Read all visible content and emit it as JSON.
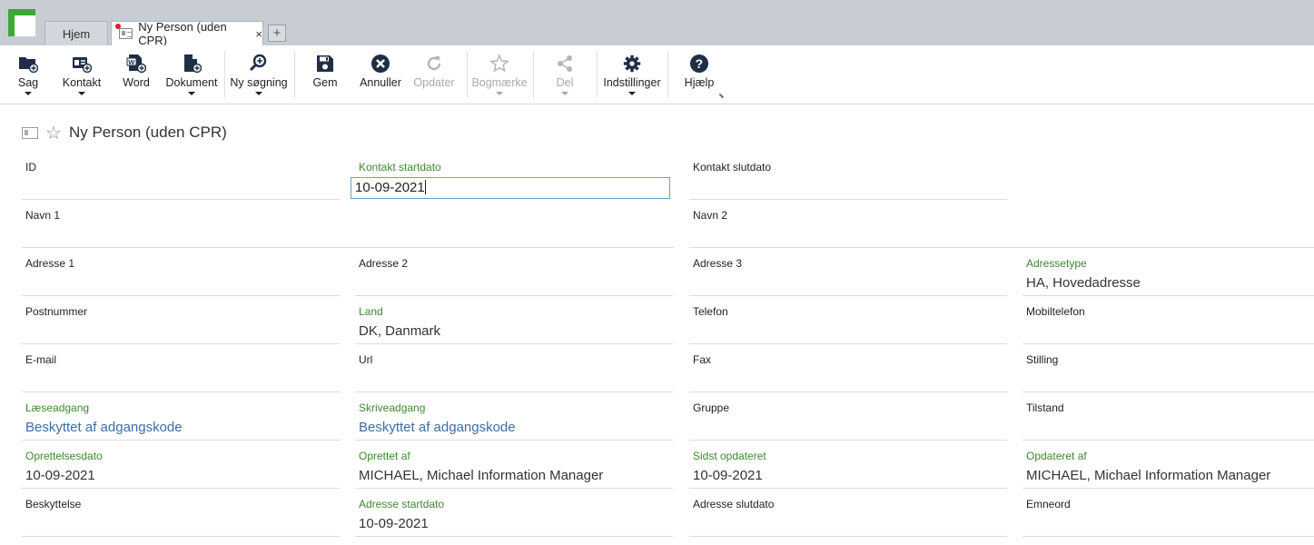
{
  "tabs": {
    "home": "Hjem",
    "active": "Ny Person (uden CPR)",
    "close": "×",
    "add": "+"
  },
  "ribbon": {
    "items": [
      {
        "label": "Sag",
        "icon": "folder-add-icon"
      },
      {
        "label": "Kontakt",
        "icon": "contact-add-icon"
      },
      {
        "label": "Word",
        "icon": "word-add-icon"
      },
      {
        "label": "Dokument",
        "icon": "document-add-icon"
      },
      {
        "label": "Ny søgning",
        "icon": "search-add-icon"
      },
      {
        "label": "Gem",
        "icon": "save-icon"
      },
      {
        "label": "Annuller",
        "icon": "cancel-icon"
      },
      {
        "label": "Opdater",
        "icon": "refresh-icon"
      },
      {
        "label": "Bogmærke",
        "icon": "star-icon"
      },
      {
        "label": "Del",
        "icon": "share-icon"
      },
      {
        "label": "Indstillinger",
        "icon": "gear-icon"
      },
      {
        "label": "Hjælp",
        "icon": "help-icon"
      }
    ],
    "corner": "⬊"
  },
  "page": {
    "title": "Ny Person (uden CPR)"
  },
  "fields": {
    "id": {
      "label": "ID",
      "value": ""
    },
    "kontakt_startdato": {
      "label": "Kontakt startdato",
      "value": "10-09-2021"
    },
    "kontakt_slutdato": {
      "label": "Kontakt slutdato",
      "value": ""
    },
    "navn1": {
      "label": "Navn 1",
      "value": ""
    },
    "navn2": {
      "label": "Navn 2",
      "value": ""
    },
    "adresse1": {
      "label": "Adresse 1",
      "value": ""
    },
    "adresse2": {
      "label": "Adresse 2",
      "value": ""
    },
    "adresse3": {
      "label": "Adresse 3",
      "value": ""
    },
    "adressetype": {
      "label": "Adressetype",
      "value": "HA, Hovedadresse"
    },
    "postnummer": {
      "label": "Postnummer",
      "value": ""
    },
    "land": {
      "label": "Land",
      "value": "DK, Danmark"
    },
    "telefon": {
      "label": "Telefon",
      "value": ""
    },
    "mobiltelefon": {
      "label": "Mobiltelefon",
      "value": ""
    },
    "email": {
      "label": "E-mail",
      "value": ""
    },
    "url": {
      "label": "Url",
      "value": ""
    },
    "fax": {
      "label": "Fax",
      "value": ""
    },
    "stilling": {
      "label": "Stilling",
      "value": ""
    },
    "laeseadgang": {
      "label": "Læseadgang",
      "value": "Beskyttet af adgangskode"
    },
    "skriveadgang": {
      "label": "Skriveadgang",
      "value": "Beskyttet af adgangskode"
    },
    "gruppe": {
      "label": "Gruppe",
      "value": ""
    },
    "tilstand": {
      "label": "Tilstand",
      "value": ""
    },
    "oprettelsesdato": {
      "label": "Oprettelsesdato",
      "value": "10-09-2021"
    },
    "oprettet_af": {
      "label": "Oprettet af",
      "value": "MICHAEL, Michael Information Manager"
    },
    "sidst_opdateret": {
      "label": "Sidst opdateret",
      "value": "10-09-2021"
    },
    "opdateret_af": {
      "label": "Opdateret af",
      "value": "MICHAEL, Michael Information Manager"
    },
    "beskyttelse": {
      "label": "Beskyttelse",
      "value": ""
    },
    "adresse_startdato": {
      "label": "Adresse startdato",
      "value": "10-09-2021"
    },
    "adresse_slutdato": {
      "label": "Adresse slutdato",
      "value": ""
    },
    "emneord": {
      "label": "Emneord",
      "value": ""
    }
  },
  "colors": {
    "required_label": "#3b8a2e",
    "link_value": "#3a6fa8",
    "focus_border": "#5aa7c6",
    "logo_green": "#3aa935"
  }
}
